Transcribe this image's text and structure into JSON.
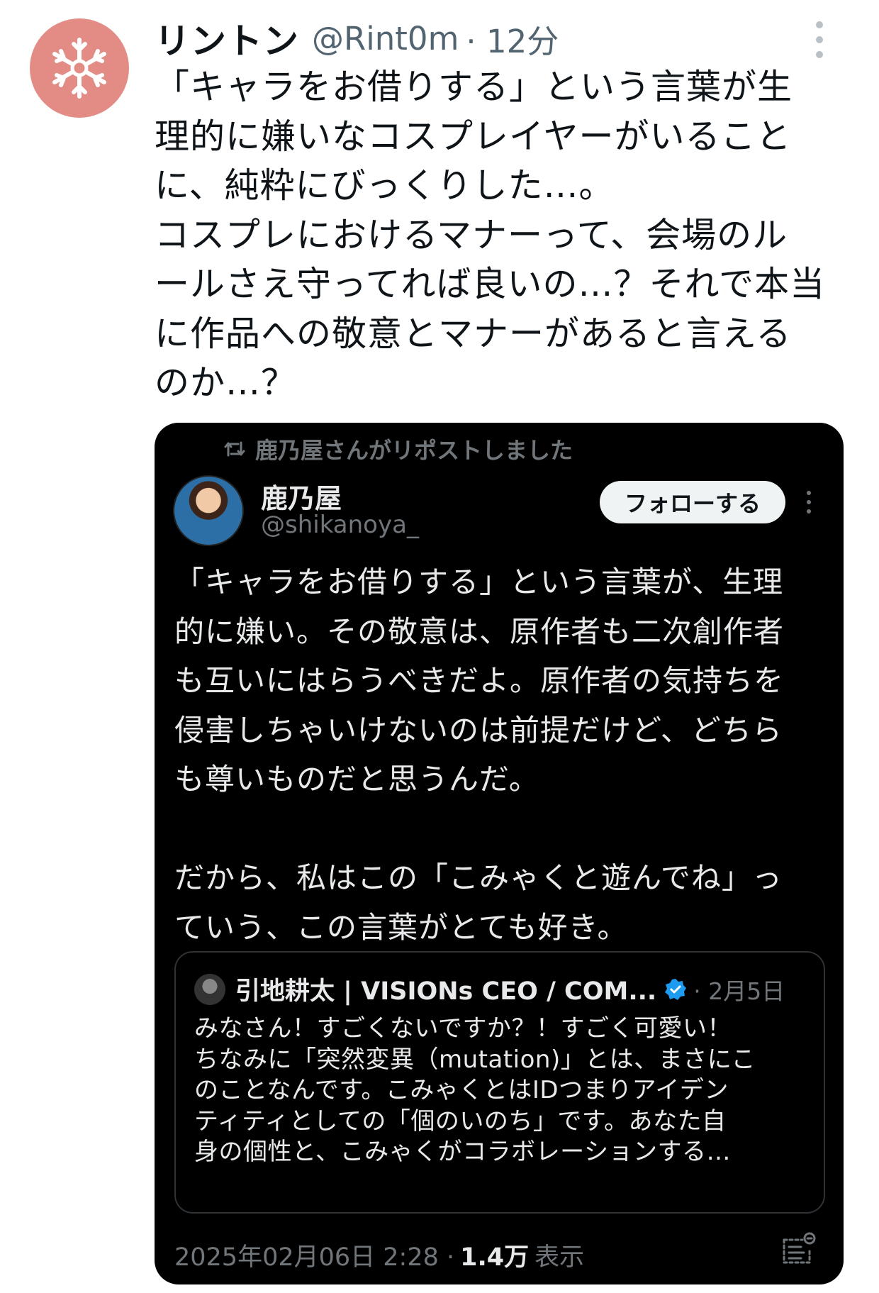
{
  "tweet": {
    "author_name": "リントン",
    "handle": "@Rint0m",
    "time": "· 12分",
    "body_lines": [
      "「キャラをお借りする」という言葉が生",
      "理的に嫌いなコスプレイヤーがいること",
      "に、純粋にびっくりした…。",
      "コスプレにおけるマナーって、会場のル",
      "ールさえ守ってれば良いの…？それで本当",
      "に作品への敬意とマナーがあると言える",
      "のか…？"
    ]
  },
  "quoted": {
    "repost_label": "鹿乃屋さんがリポストしました",
    "author_name": "鹿乃屋",
    "handle": "@shikanoya_",
    "follow_label": "フォローする",
    "body_lines": [
      "「キャラをお借りする」という言葉が、生理",
      "的に嫌い。その敬意は、原作者も二次創作者",
      "も互いにはらうべきだよ。原作者の気持ちを",
      "侵害しちゃいけないのは前提だけど、どちら",
      "も尊いものだと思うんだ。",
      "",
      "だから、私はこの「こみゃくと遊んでね」っ",
      "ていう、この言葉がとても好き。"
    ],
    "embedded": {
      "author_name": "引地耕太 | VISIONs CEO / COM...",
      "date": "· 2月5日",
      "body_lines": [
        "みなさん！すごくないですか？！すごく可愛い！",
        "ちなみに「突然変異（mutation)」とは、まさにこ",
        "のことなんです。こみゃくとはIDつまりアイデン",
        "ティティとしての「個のいのち」です。あなた自",
        "身の個性と、こみゃくがコラボレーションする…"
      ]
    },
    "footer": {
      "timestamp": "2025年02月06日 2:28 ·",
      "views_count": "1.4万",
      "views_label": "表示"
    }
  },
  "colors": {
    "avatar_bg": "#e38c86",
    "card_bg": "#000000",
    "verified": "#1d9bf0",
    "muted": "#536471"
  },
  "icons": [
    "snowflake-emblem-icon",
    "more-options-icon",
    "repost-icon",
    "verified-badge-icon",
    "notes-icon"
  ]
}
